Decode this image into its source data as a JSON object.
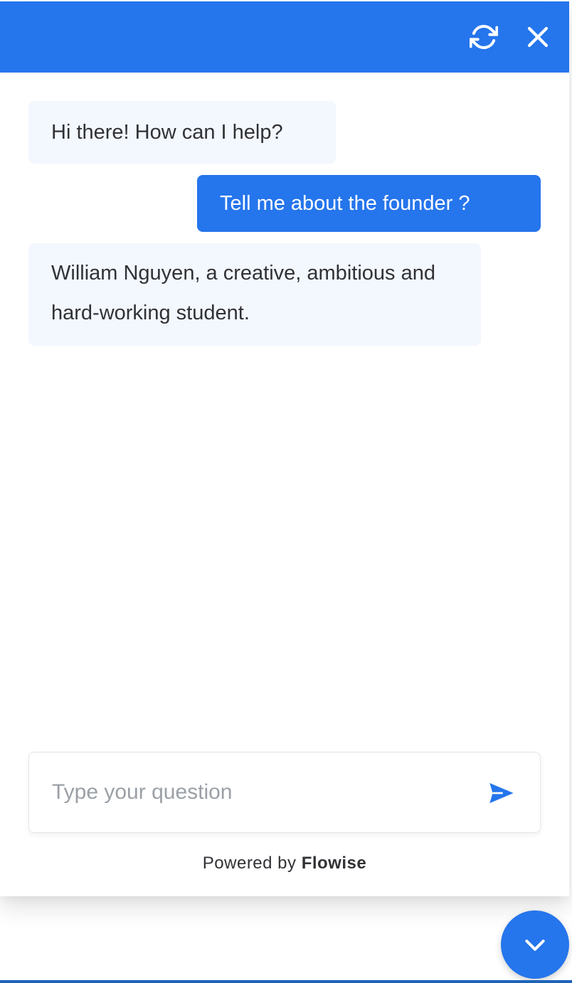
{
  "header": {
    "background_color": "#2575ec",
    "refresh_icon": "refresh-icon",
    "close_icon": "close-icon"
  },
  "messages": [
    {
      "role": "bot",
      "text": "Hi there! How can I help?"
    },
    {
      "role": "user",
      "text": "Tell me about the founder ?"
    },
    {
      "role": "bot",
      "text": "William Nguyen, a creative, ambitious and hard-working student."
    }
  ],
  "input": {
    "placeholder": "Type your question",
    "value": "",
    "send_icon": "send-icon"
  },
  "footer": {
    "powered_prefix": "Powered by ",
    "powered_brand": "Flowise"
  },
  "toggle_button": {
    "icon": "chevron-down-icon"
  },
  "colors": {
    "accent": "#2575ec",
    "bot_bubble": "#f3f7fe",
    "text": "#303235"
  }
}
